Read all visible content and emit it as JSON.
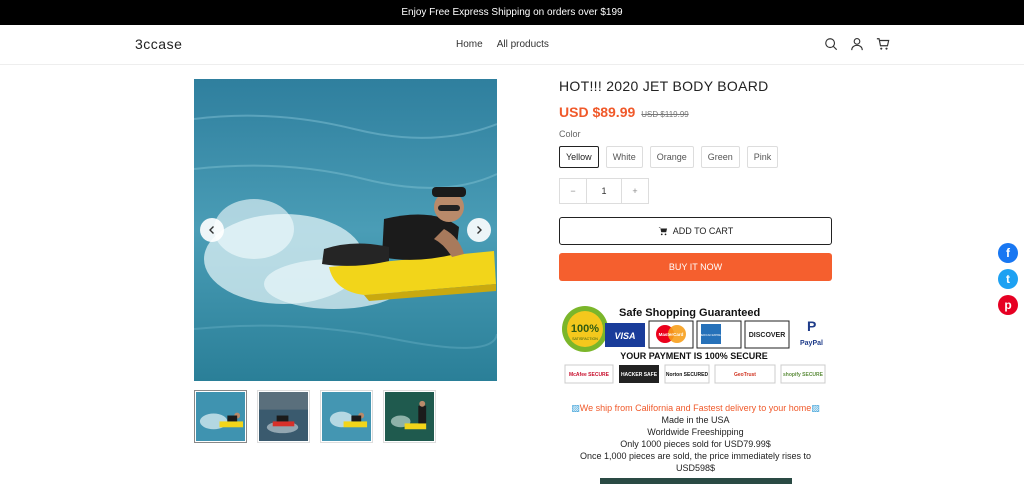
{
  "announcement": "Enjoy Free Express Shipping on orders over $199",
  "header": {
    "logo": "3ccase",
    "nav": [
      "Home",
      "All products"
    ],
    "icons": [
      "search-icon",
      "account-icon",
      "cart-icon"
    ]
  },
  "gallery": {
    "prev_icon": "chevron-left-icon",
    "next_icon": "chevron-right-icon",
    "thumbnails": 4,
    "active_thumbnail": 1
  },
  "product": {
    "title": "HOT!!! 2020 JET BODY BOARD",
    "price": "USD $89.99",
    "compare_price": "USD $119.99",
    "color_label": "Color",
    "colors": [
      "Yellow",
      "White",
      "Orange",
      "Green",
      "Pink"
    ],
    "selected_color": "Yellow",
    "qty_minus": "−",
    "qty_value": "1",
    "qty_plus": "+",
    "add_to_cart": "ADD TO CART",
    "buy_now": "BUY IT NOW"
  },
  "trust_badge": {
    "guarantee_text": "100%",
    "guarantee_sub": "SATISFACTION",
    "heading": "Safe Shopping Guaranteed",
    "payment_text": "YOUR PAYMENT IS 100% SECURE",
    "cards": [
      "VISA",
      "MasterCard",
      "AMERICAN EXPRESS",
      "DISCOVER",
      "PayPal"
    ],
    "security": [
      "McAfee SECURE",
      "HACKER SAFE",
      "Norton SECURED",
      "GeoTrust",
      "shopify SECURE"
    ]
  },
  "description": {
    "shipping_line": "We ship from California and Fastest delivery to your home",
    "lines": [
      "Made in the USA",
      "Worldwide Freeshipping",
      "Only 1000 pieces sold for USD79.99$",
      "Once 1,000 pieces are sold, the price immediately rises to",
      "USD598$"
    ]
  },
  "social": [
    {
      "name": "facebook-icon",
      "glyph": "f",
      "color": "#1877f2"
    },
    {
      "name": "twitter-icon",
      "glyph": "t",
      "color": "#1da1f2"
    },
    {
      "name": "pinterest-icon",
      "glyph": "p",
      "color": "#e60023"
    }
  ],
  "colors": {
    "accent": "#f55f2e",
    "price": "#f0592a"
  }
}
